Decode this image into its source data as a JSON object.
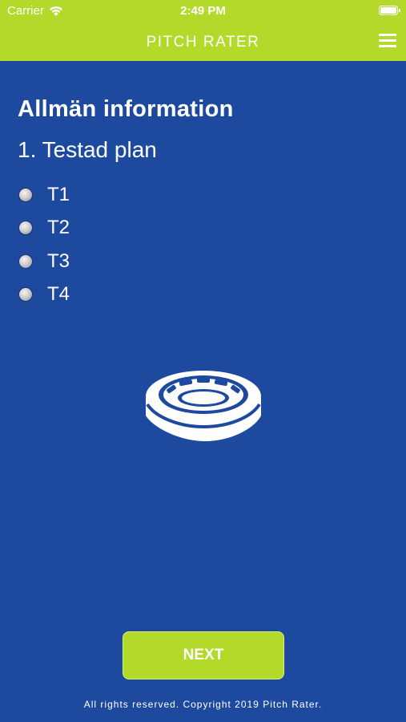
{
  "status_bar": {
    "carrier": "Carrier",
    "time": "2:49 PM"
  },
  "header": {
    "title": "PITCH RATER",
    "menu_icon": "hamburger-menu-icon"
  },
  "section": {
    "title": "Allmän information"
  },
  "question": {
    "text": "1. Testad plan",
    "options": [
      {
        "label": "T1",
        "selected": false
      },
      {
        "label": "T2",
        "selected": false
      },
      {
        "label": "T3",
        "selected": false
      },
      {
        "label": "T4",
        "selected": false
      }
    ]
  },
  "illustration": {
    "icon": "stadium-icon"
  },
  "actions": {
    "next_label": "NEXT"
  },
  "footer": {
    "copyright": "All rights reserved. Copyright 2019 Pitch Rater."
  },
  "colors": {
    "accent_green": "#b3d92a",
    "background_blue": "#1d4a9e",
    "text": "#ffffff"
  }
}
